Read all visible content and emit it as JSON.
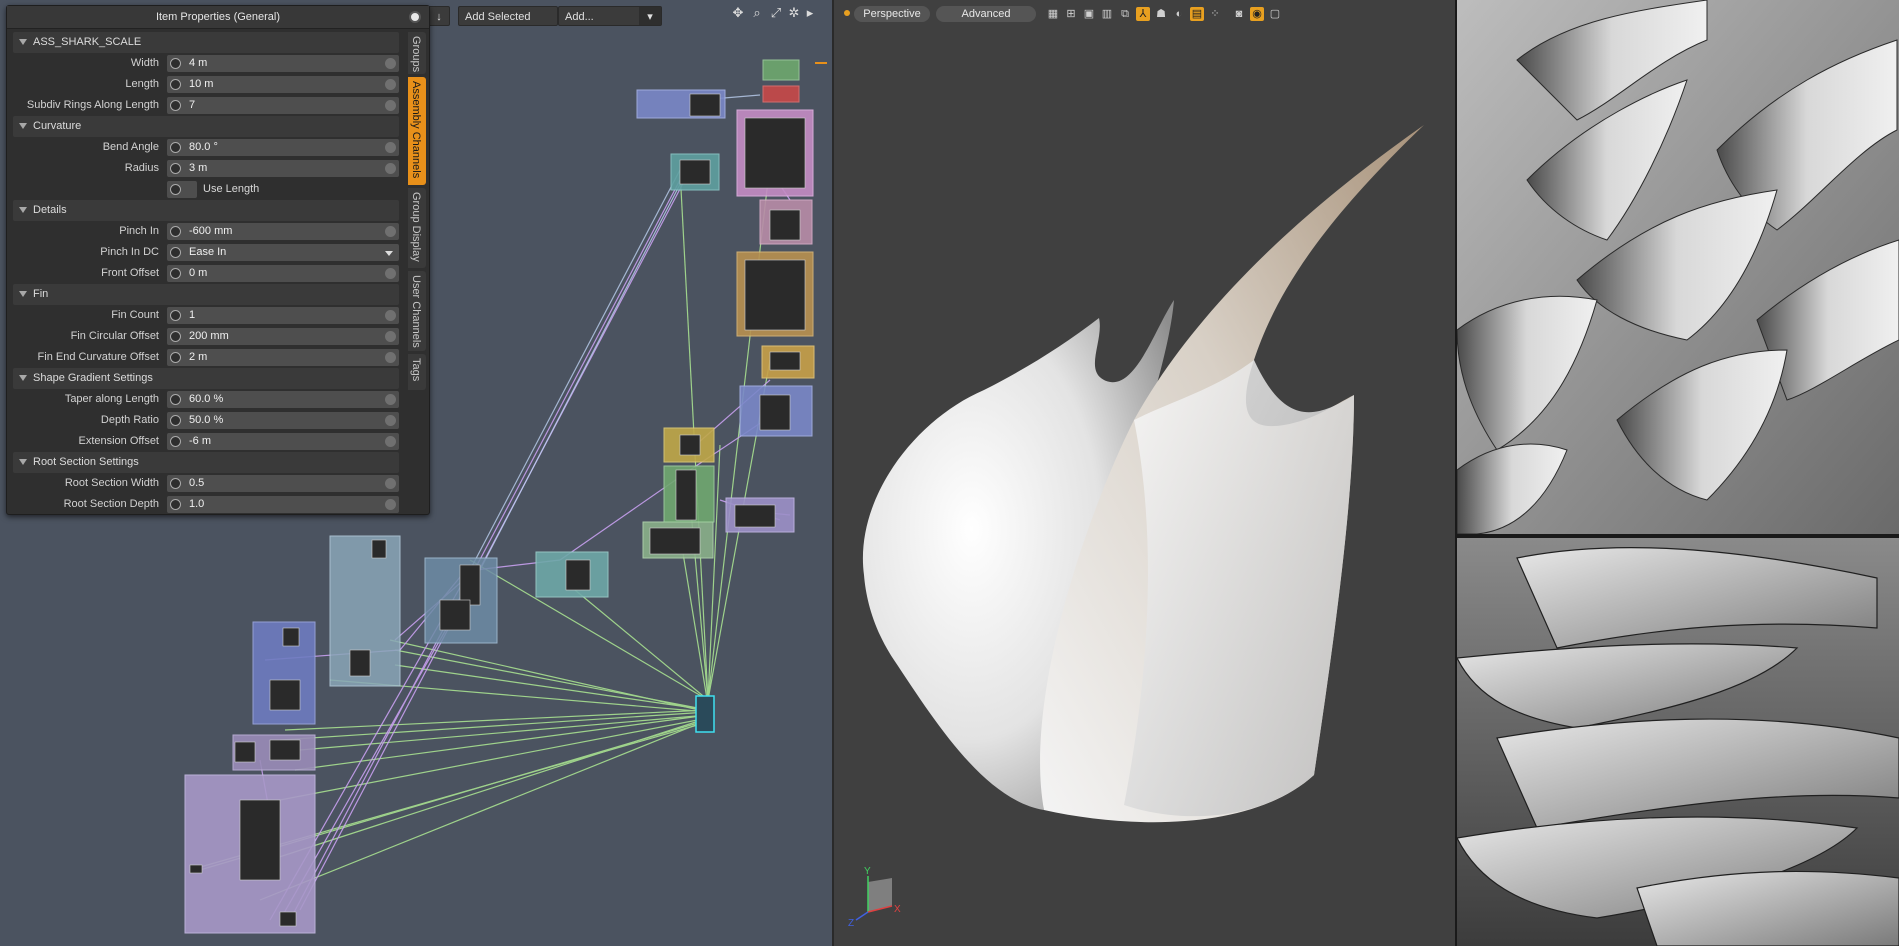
{
  "properties_panel": {
    "title": "Item Properties (General)",
    "sections": [
      {
        "type": "section",
        "label": "ASS_SHARK_SCALE"
      },
      {
        "type": "field",
        "label": "Width",
        "value": "4 m"
      },
      {
        "type": "field",
        "label": "Length",
        "value": "10 m"
      },
      {
        "type": "field",
        "label": "Subdiv Rings Along Length",
        "value": "7"
      },
      {
        "type": "section",
        "label": "Curvature"
      },
      {
        "type": "field",
        "label": "Bend Angle",
        "value": "80.0 °"
      },
      {
        "type": "field",
        "label": "Radius",
        "value": "3 m"
      },
      {
        "type": "checkbox",
        "label": "Use Length"
      },
      {
        "type": "section",
        "label": "Details"
      },
      {
        "type": "field",
        "label": "Pinch In",
        "value": "-600 mm"
      },
      {
        "type": "dropdown",
        "label": "Pinch In DC",
        "value": "Ease In"
      },
      {
        "type": "field",
        "label": "Front Offset",
        "value": "0 m"
      },
      {
        "type": "section",
        "label": "Fin"
      },
      {
        "type": "field",
        "label": "Fin Count",
        "value": "1"
      },
      {
        "type": "field",
        "label": "Fin Circular Offset",
        "value": "200 mm"
      },
      {
        "type": "field",
        "label": "Fin End Curvature Offset",
        "value": "2 m"
      },
      {
        "type": "section",
        "label": "Shape Gradient Settings"
      },
      {
        "type": "field",
        "label": "Taper along Length",
        "value": "60.0 %"
      },
      {
        "type": "field",
        "label": "Depth Ratio",
        "value": "50.0 %"
      },
      {
        "type": "field",
        "label": "Extension Offset",
        "value": "-6 m"
      },
      {
        "type": "section",
        "label": "Root Section Settings"
      },
      {
        "type": "field",
        "label": "Root Section Width",
        "value": "0.5"
      },
      {
        "type": "field",
        "label": "Root Section Depth",
        "value": "1.0"
      }
    ],
    "side_tabs": [
      {
        "label": "Groups",
        "active": false
      },
      {
        "label": "Assembly Channels",
        "active": true
      },
      {
        "label": "Group Display",
        "active": false
      },
      {
        "label": "User Channels",
        "active": false
      },
      {
        "label": "Tags",
        "active": false
      }
    ]
  },
  "schematic_toolbar": {
    "add_selected": "Add Selected",
    "add_menu": "Add...",
    "icons": [
      "move-icon",
      "search-icon",
      "fit-icon",
      "gear-icon",
      "play-icon"
    ]
  },
  "viewport": {
    "view_mode": "Perspective",
    "shading_mode": "Advanced",
    "axis_labels": {
      "y": "Y",
      "x": "X",
      "z": "Z"
    },
    "accent": "#e8a020",
    "model_color": "#e9e9e9",
    "tip_color": "#b8a28a"
  },
  "colors": {
    "schematic_bg": "#4b5360",
    "panel_bg": "#2f2f2f",
    "tab_active": "#e8901a",
    "link_green": "#a8e090",
    "link_purple": "#c8a0f0"
  }
}
